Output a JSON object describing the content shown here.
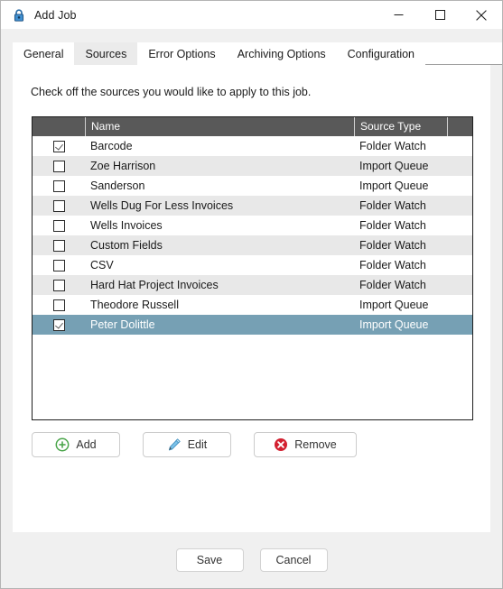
{
  "window": {
    "title": "Add Job",
    "icon": "lock-icon",
    "controls": {
      "minimize": "minimize-icon",
      "maximize": "maximize-icon",
      "close": "close-icon"
    }
  },
  "tabs": [
    {
      "label": "General",
      "active": false
    },
    {
      "label": "Sources",
      "active": true
    },
    {
      "label": "Error Options",
      "active": false
    },
    {
      "label": "Archiving Options",
      "active": false
    },
    {
      "label": "Configuration",
      "active": false
    }
  ],
  "content": {
    "instruction": "Check off the sources you would like to apply to this job.",
    "list": {
      "columns": [
        "",
        "Name",
        "Source Type",
        ""
      ],
      "rows": [
        {
          "checked": true,
          "name": "Barcode",
          "type": "Folder Watch",
          "selected": false
        },
        {
          "checked": false,
          "name": "Zoe Harrison",
          "type": "Import Queue",
          "selected": false
        },
        {
          "checked": false,
          "name": "Sanderson",
          "type": "Import Queue",
          "selected": false
        },
        {
          "checked": false,
          "name": "Wells Dug For Less Invoices",
          "type": "Folder Watch",
          "selected": false
        },
        {
          "checked": false,
          "name": "Wells Invoices",
          "type": "Folder Watch",
          "selected": false
        },
        {
          "checked": false,
          "name": "Custom Fields",
          "type": "Folder Watch",
          "selected": false
        },
        {
          "checked": false,
          "name": "CSV",
          "type": "Folder Watch",
          "selected": false
        },
        {
          "checked": false,
          "name": "Hard Hat Project Invoices",
          "type": "Folder Watch",
          "selected": false
        },
        {
          "checked": false,
          "name": "Theodore Russell",
          "type": "Import Queue",
          "selected": false
        },
        {
          "checked": true,
          "name": "Peter Dolittle",
          "type": "Import Queue",
          "selected": true
        }
      ]
    },
    "actions": [
      {
        "label": "Add",
        "icon": "plus-circle-icon",
        "color": "#4ba64b"
      },
      {
        "label": "Edit",
        "icon": "pencil-icon",
        "color": "#4aa3d9"
      },
      {
        "label": "Remove",
        "icon": "delete-circle-icon",
        "color": "#d32030"
      }
    ]
  },
  "footer": {
    "save": "Save",
    "cancel": "Cancel"
  },
  "colors": {
    "selection": "#76a0b4",
    "header": "#595959",
    "alt_row": "#e8e8e8",
    "window_bg": "#f0f0f0"
  }
}
